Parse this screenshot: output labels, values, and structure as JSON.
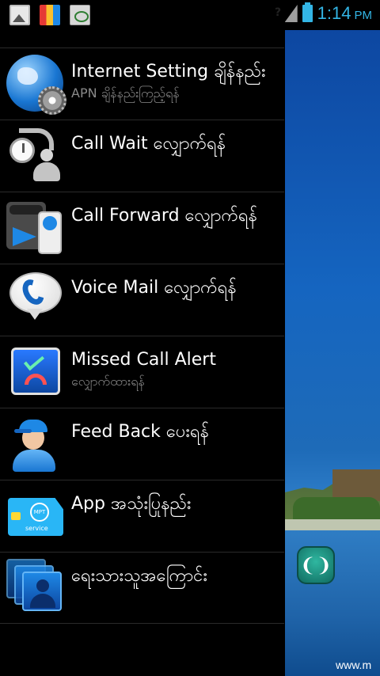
{
  "status_bar": {
    "notification_icons": [
      "gallery-icon",
      "app-store-icon",
      "cc-icon"
    ],
    "unknown_sim_glyph": "?",
    "time": "1:14",
    "ampm": "PM",
    "accent_color": "#33b5e5"
  },
  "menu": {
    "items": [
      {
        "title": "Internet Setting ချိန်နည်း",
        "subtitle": "APN ချိန်နည်းကြည့်ရန်",
        "icon": "globe-gear-icon"
      },
      {
        "title": "Call Wait လျှောက်ရန်",
        "subtitle": "",
        "icon": "call-wait-icon"
      },
      {
        "title": "Call Forward လျှောက်ရန်",
        "subtitle": "",
        "icon": "call-forward-icon"
      },
      {
        "title": "Voice Mail လျှောက်ရန်",
        "subtitle": "",
        "icon": "voice-mail-icon"
      },
      {
        "title": "Missed Call Alert",
        "subtitle": "လျှောက်ထားရန်",
        "icon": "missed-call-icon"
      },
      {
        "title": "Feed Back ပေးရန်",
        "subtitle": "",
        "icon": "feedback-person-icon"
      },
      {
        "title": "App အသုံးပြုနည်း",
        "subtitle": "",
        "icon": "mpt-service-card-icon"
      },
      {
        "title": "ရေးသားသူအကြောင်း",
        "subtitle": "",
        "icon": "contacts-icon"
      }
    ]
  },
  "wallpaper": {
    "handle_glyph": "❨❩",
    "url_text": "www.m"
  },
  "app_icon_text": {
    "logo": "MPT",
    "service": "service"
  }
}
